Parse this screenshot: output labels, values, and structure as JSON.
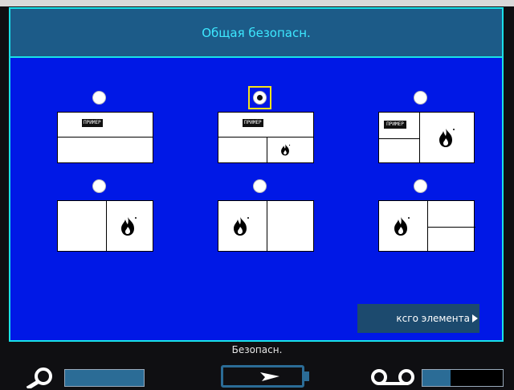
{
  "header": {
    "title": "Общая безопасн."
  },
  "options": [
    {
      "selected": false,
      "layout": "two-rows",
      "tag": "ПРИМЕР"
    },
    {
      "selected": true,
      "layout": "top-row-bottom-split",
      "tag": "ПРИМЕР"
    },
    {
      "selected": false,
      "layout": "left-split-right-icon",
      "tag": "ПРИМЕР"
    },
    {
      "selected": false,
      "layout": "left-empty-right-icon"
    },
    {
      "selected": false,
      "layout": "left-icon-right-empty"
    },
    {
      "selected": false,
      "layout": "left-icon-right-split"
    }
  ],
  "footer": {
    "button_label": "ксго элемента"
  },
  "status": {
    "text": "Безопасн."
  },
  "colors": {
    "screen": "#0018e6",
    "accent": "#19e0e8",
    "title": "#3de8ff",
    "selection": "#f5e21a"
  },
  "icons": {
    "left": "search-icon",
    "center": "battery-icon",
    "right": "tape-icon"
  },
  "meter": {
    "fill_fraction": 0.35
  }
}
